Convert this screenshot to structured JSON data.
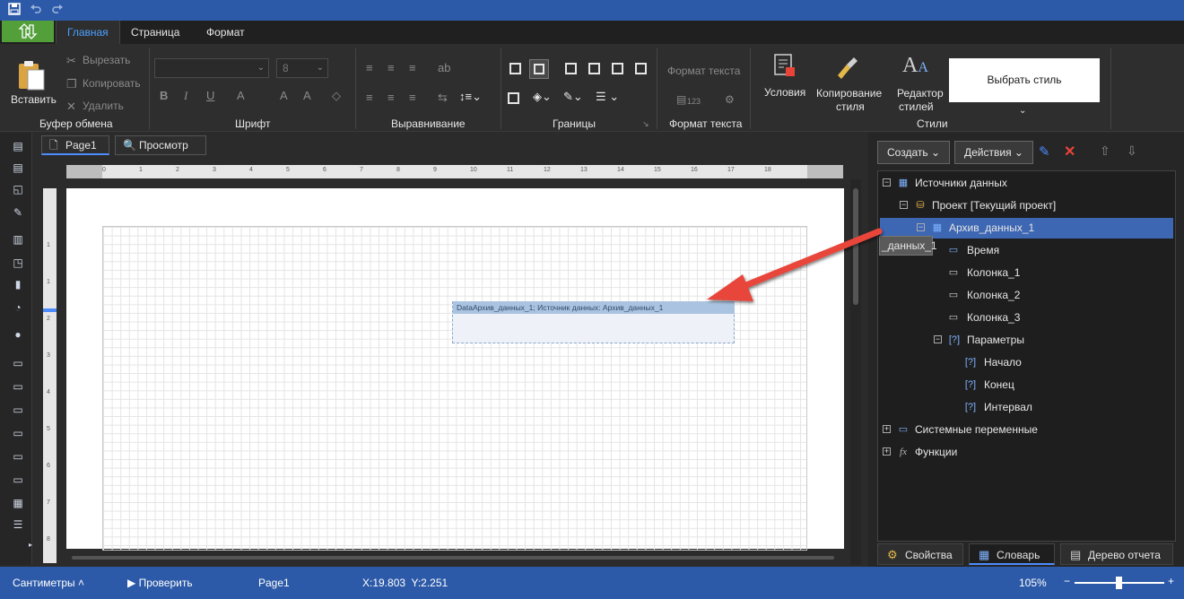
{
  "tabs": {
    "main": "Главная",
    "page": "Страница",
    "format": "Формат"
  },
  "clipboard": {
    "paste": "Вставить",
    "cut": "Вырезать",
    "copy": "Копировать",
    "delete": "Удалить",
    "group": "Буфер обмена"
  },
  "font": {
    "size": "8",
    "group": "Шрифт"
  },
  "align": {
    "group": "Выравнивание"
  },
  "borders": {
    "group": "Границы"
  },
  "textformat": {
    "label": "Формат текста",
    "group": "Формат текста",
    "num": "123"
  },
  "styles": {
    "conditions": "Условия",
    "copy_style_1": "Копирование",
    "copy_style_2": "стиля",
    "editor_1": "Редактор",
    "editor_2": "стилей",
    "choose": "Выбрать стиль",
    "group": "Стили"
  },
  "doc_tabs": {
    "page1": "Page1",
    "preview": "Просмотр"
  },
  "ruler": {
    "h": [
      "0",
      "1",
      "2",
      "3",
      "4",
      "5",
      "6",
      "7",
      "8",
      "9",
      "10",
      "11",
      "12",
      "13",
      "14",
      "15",
      "16",
      "17",
      "18"
    ],
    "v": [
      "1",
      "1",
      "2",
      "3",
      "4",
      "5",
      "6",
      "7",
      "8",
      "9"
    ]
  },
  "band": {
    "header": "DataАрхив_данных_1; Источник данных: Архив_данных_1"
  },
  "panel": {
    "create": "Создать",
    "actions": "Действия"
  },
  "tree": {
    "datasources": "Источники данных",
    "project": "Проект [Текущий проект]",
    "archive": "Архив_данных_1",
    "time": "Время",
    "col1": "Колонка_1",
    "col2": "Колонка_2",
    "col3": "Колонка_3",
    "params": "Параметры",
    "start": "Начало",
    "end": "Конец",
    "interval": "Интервал",
    "sysvars": "Системные переменные",
    "functions": "Функции"
  },
  "tooltip": "_данных_1",
  "bottom_tabs": {
    "properties": "Свойства",
    "dictionary": "Словарь",
    "report_tree": "Дерево отчета"
  },
  "status": {
    "units": "Сантиметры",
    "check": "Проверить",
    "page": "Page1",
    "coords": "X:19.803  Y:2.251",
    "zoom": "105%"
  },
  "colors": {
    "accent": "#2d5aa8",
    "selection": "#3d66b3",
    "app_button": "#53a03a",
    "arrow": "#e8443a"
  }
}
